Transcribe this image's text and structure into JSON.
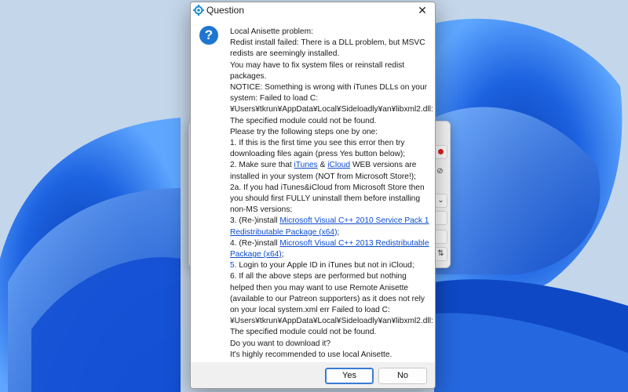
{
  "dialog": {
    "title": "Question",
    "icon": "question-icon",
    "message": {
      "l1": "Local Anisette problem:",
      "l2": "Redist install failed: There is a DLL problem, but MSVC",
      "l3": "redists are seemingly installed.",
      "l4": "You may have to fix system files or reinstall redist",
      "l5": "packages.",
      "l6": "NOTICE: Something is wrong with iTunes DLLs on your",
      "l7": "system: Failed to load C:",
      "l8": "¥Users¥tkrun¥AppData¥Local¥Sideloadly¥an¥libxml2.dll:",
      "l9": "The specified module could not be found.",
      "l10": "Please try the following steps one by one:",
      "l11": "1. If this is the first time you see this error then try",
      "l12": "downloading files again (press Yes button below);",
      "l13_pre": "2. Make sure that ",
      "l13_link1": "iTunes",
      "l13_mid": " & ",
      "l13_link2": "iCloud",
      "l13_post": " WEB versions are",
      "l14": "installed in your system (NOT from Microsoft Store!);",
      "l15": "2a. If you had iTunes&iCloud from Microsoft Store then",
      "l16": "you should first FULLY uninstall them before installing",
      "l17": "non-MS versions;",
      "l18_pre": "3. (Re-)install ",
      "l18_link": "Microsoft Visual C++ 2010 Service Pack 1",
      "l19_link": "Redistributable Package (x64)",
      "l19_post": ";",
      "l20_pre": "4. (Re-)install ",
      "l20_link": "Microsoft Visual C++ 2013 Redistributable",
      "l21_link": "Package (x64)",
      "l21_post": ";",
      "l22_blue": "5.",
      "l22_rest": " Login to your Apple ID in iTunes but not in iCloud;",
      "l23": "6. If all the above steps are performed but nothing",
      "l24": "helped then you may want to use Remote Anisette",
      "l25": "(available to our Patreon supporters) as it does not rely",
      "l26": "on your local system.xml err Failed to load C:",
      "l27": "¥Users¥tkrun¥AppData¥Local¥Sideloadly¥an¥libxml2.dll:",
      "l28": "The specified module could not be found.",
      "l29": "Do you want to download it?",
      "l30": "It's highly recommended to use local Anisette."
    },
    "buttons": {
      "yes": "Yes",
      "no": "No"
    }
  },
  "background_window": {
    "controls": [
      "⇅",
      "⇅"
    ]
  },
  "colors": {
    "link": "#0b4bcf",
    "accent": "#1e76d0",
    "wallpaper": "#c4d6ea"
  }
}
